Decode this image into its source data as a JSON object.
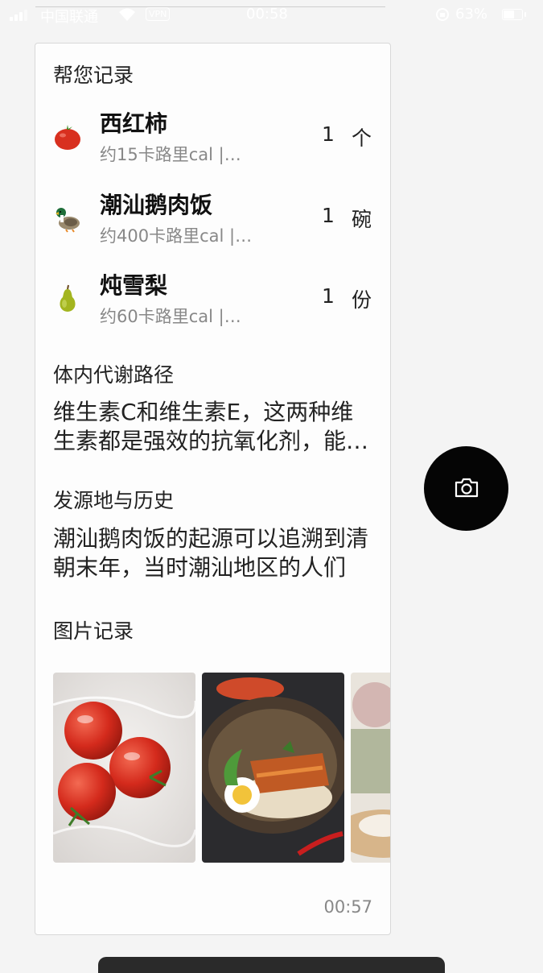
{
  "status_bar": {
    "carrier": "中国联通",
    "vpn": "VPN",
    "time": "00:58",
    "battery": "63%",
    "battery_level": 0.63
  },
  "record": {
    "title": "帮您记录",
    "items": [
      {
        "icon": "tomato-icon",
        "name": "西红柿",
        "calories": "约15卡路里cal  |…",
        "qty": "1",
        "unit": "个"
      },
      {
        "icon": "duck-icon",
        "name": "潮汕鹅肉饭",
        "calories": "约400卡路里cal  |…",
        "qty": "1",
        "unit": "碗"
      },
      {
        "icon": "pear-icon",
        "name": "炖雪梨",
        "calories": "约60卡路里cal  |…",
        "qty": "1",
        "unit": "份"
      }
    ]
  },
  "metabolism": {
    "title": "体内代谢路径",
    "text": "维生素C和维生素E，这两种维生素都是强效的抗氧化剂，能够帮助身体清除自由基"
  },
  "origin": {
    "title": "发源地与历史",
    "text": "潮汕鹅肉饭的起源可以追溯到清朝末年，当时潮汕地区的人们"
  },
  "photos": {
    "title": "图片记录",
    "items": [
      "tomato-photo",
      "goose-rice-photo",
      "pear-photo"
    ]
  },
  "timestamp": "00:57",
  "camera": {
    "icon": "camera-icon"
  },
  "colors": {
    "card_bg": "#fdfdfd",
    "page_bg": "#f4f4f4",
    "fab": "#050505",
    "muted_text": "#888888"
  }
}
